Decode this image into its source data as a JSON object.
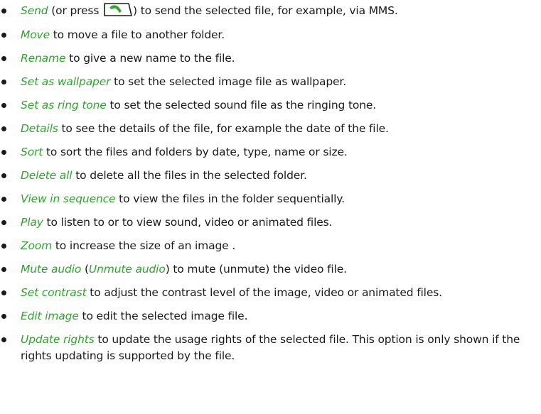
{
  "items": [
    {
      "opt": "Send",
      "a": " (or press ",
      "key_icon": "call-key-icon",
      "b": ") to send the selected file, for example, via MMS."
    },
    {
      "opt": "Move",
      "text": " to move a file to another folder."
    },
    {
      "opt": "Rename",
      "text": " to give a new name to the file."
    },
    {
      "opt": "Set as wallpaper",
      "text": " to set the selected image file as wallpaper."
    },
    {
      "opt": "Set as ring tone",
      "text": " to set the selected sound file as the ringing tone."
    },
    {
      "opt": "Details",
      "text": " to see the details of the file, for example the date of the file."
    },
    {
      "opt": "Sort",
      "text": " to sort the files and folders by date, type, name or size."
    },
    {
      "opt": "Delete all",
      "text": " to delete all the files in the selected folder."
    },
    {
      "opt": "View in sequence",
      "text": " to view the files in the folder sequentially."
    },
    {
      "opt": "Play",
      "text": " to listen to or to view sound, video or animated files."
    },
    {
      "opt": "Zoom",
      "text": " to increase the size of an image ."
    },
    {
      "opt": "Mute audio",
      "a": " (",
      "opt2": "Unmute audio",
      "b": ") to mute (unmute) the video file."
    },
    {
      "opt": "Set contrast",
      "text": " to adjust the contrast level of the image, video or animated files."
    },
    {
      "opt": "Edit image",
      "text": " to edit the selected image file."
    },
    {
      "opt": "Update rights",
      "text": " to update the usage rights of the selected file. This option is only shown if the rights updating is supported by the file."
    }
  ],
  "colors": {
    "option_text": "#2fa52c",
    "body_text": "#1a1a1a",
    "key_fill": "#2fa52c"
  }
}
